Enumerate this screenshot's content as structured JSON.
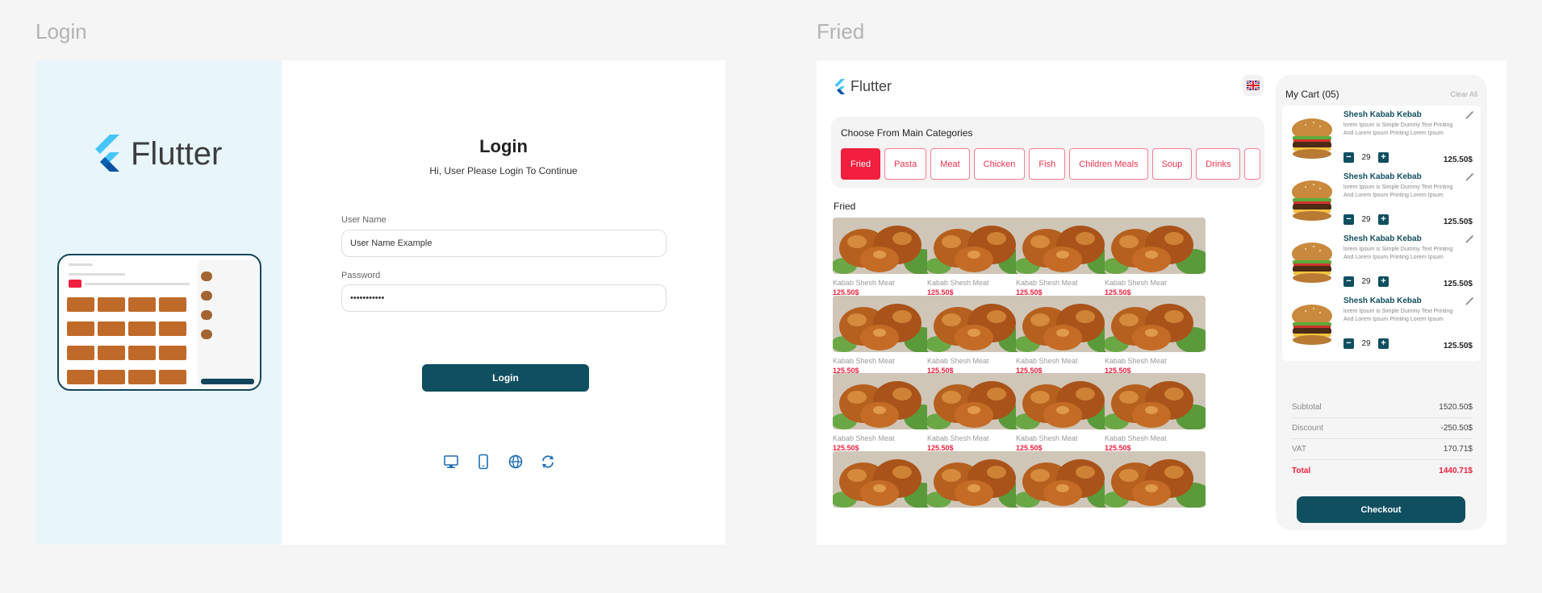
{
  "frames": {
    "login_label": "Login",
    "fried_label": "Fried"
  },
  "login": {
    "logo_text": "Flutter",
    "title": "Login",
    "subtitle": "Hi, User Please Login To Continue",
    "username_label": "User Name",
    "username_value": "User Name Example",
    "password_label": "Password",
    "password_value": "•••••••••••",
    "button_label": "Login",
    "platform_icons": [
      "desktop-icon",
      "mobile-icon",
      "web-icon",
      "sync-icon"
    ]
  },
  "fried": {
    "logo_text": "Flutter",
    "language_icon": "uk-flag-icon",
    "categories_title": "Choose From Main Categories",
    "categories": [
      "Fried",
      "Pasta",
      "Meat",
      "Chicken",
      "Fish",
      "Children Meals",
      "Soup",
      "Drinks"
    ],
    "active_category": "Fried",
    "section_title": "Fried",
    "items": [
      {
        "name": "Kabab Shesh Meat",
        "price": "125.50$"
      },
      {
        "name": "Kabab Shesh Meat",
        "price": "125.50$"
      },
      {
        "name": "Kabab Shesh Meat",
        "price": "125.50$"
      },
      {
        "name": "Kabab Shesh Meat",
        "price": "125.50$"
      },
      {
        "name": "Kabab Shesh Meat",
        "price": "125.50$"
      },
      {
        "name": "Kabab Shesh Meat",
        "price": "125.50$"
      },
      {
        "name": "Kabab Shesh Meat",
        "price": "125.50$"
      },
      {
        "name": "Kabab Shesh Meat",
        "price": "125.50$"
      },
      {
        "name": "Kabab Shesh Meat",
        "price": "125.50$"
      },
      {
        "name": "Kabab Shesh Meat",
        "price": "125.50$"
      },
      {
        "name": "Kabab Shesh Meat",
        "price": "125.50$"
      },
      {
        "name": "Kabab Shesh Meat",
        "price": "125.50$"
      },
      {
        "name": "",
        "price": ""
      },
      {
        "name": "",
        "price": ""
      },
      {
        "name": "",
        "price": ""
      },
      {
        "name": "",
        "price": ""
      }
    ],
    "cart": {
      "title": "My Cart (05)",
      "clear_all": "Clear All",
      "items": [
        {
          "title": "Shesh Kabab Kebab",
          "desc": "lorem Ipsum  is Simple Dummy Text Printing And Lorem Ipsum Printing Lorem Ipsum",
          "qty": "29",
          "price": "125.50$"
        },
        {
          "title": "Shesh Kabab Kebab",
          "desc": "lorem Ipsum  is Simple Dummy Text Printing And Lorem Ipsum Printing Lorem Ipsum",
          "qty": "29",
          "price": "125.50$"
        },
        {
          "title": "Shesh Kabab Kebab",
          "desc": "lorem Ipsum  is Simple Dummy Text Printing And Lorem Ipsum Printing Lorem Ipsum",
          "qty": "29",
          "price": "125.50$"
        },
        {
          "title": "Shesh Kabab Kebab",
          "desc": "lorem Ipsum  is Simple Dummy Text Printing And Lorem Ipsum Printing Lorem Ipsum",
          "qty": "29",
          "price": "125.50$"
        }
      ],
      "subtotal_label": "Subtotal",
      "subtotal_value": "1520.50$",
      "discount_label": "Discount",
      "discount_value": "-250.50$",
      "vat_label": "VAT",
      "vat_value": "170.71$",
      "total_label": "Total",
      "total_value": "1440.71$",
      "checkout_label": "Checkout"
    }
  },
  "colors": {
    "primary": "#0f4f60",
    "accent": "#f21f3f",
    "login_panel_bg": "#e8f6fc"
  }
}
